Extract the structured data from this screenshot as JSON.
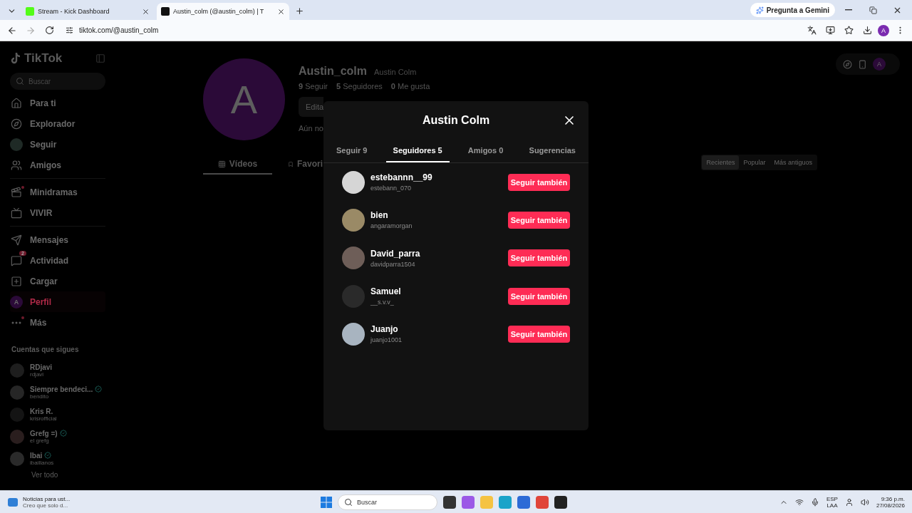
{
  "browser": {
    "tabs": [
      {
        "title": "Stream - Kick Dashboard",
        "selected": false
      },
      {
        "title": "Austin_colm (@austin_colm) | T",
        "selected": true
      }
    ],
    "gemini": "Pregunta a Gemini",
    "url": "tiktok.com/@austin_colm",
    "profile_initial": "A"
  },
  "sidebar": {
    "logo": "TikTok",
    "search": {
      "placeholder": "Buscar"
    },
    "groups": [
      [
        {
          "label": "Para ti",
          "kind": "icon",
          "selected": false,
          "dot": false
        },
        {
          "label": "Explorador",
          "kind": "icon",
          "selected": false,
          "dot": false
        },
        {
          "label": "Seguir",
          "kind": "photo",
          "selected": false,
          "dot": false
        },
        {
          "label": "Amigos",
          "kind": "icon",
          "selected": false,
          "dot": false
        }
      ],
      [
        {
          "label": "Minidramas",
          "kind": "icon",
          "selected": false,
          "dot": true
        },
        {
          "label": "VIVIR",
          "kind": "icon",
          "selected": false,
          "dot": false
        }
      ],
      [
        {
          "label": "Mensajes",
          "kind": "icon",
          "selected": false,
          "dot": false
        },
        {
          "label": "Actividad",
          "kind": "icon",
          "selected": false,
          "dot": false,
          "badge": "2"
        },
        {
          "label": "Cargar",
          "kind": "icon",
          "selected": false,
          "dot": false
        },
        {
          "label": "Perfil",
          "kind": "initial",
          "initial": "A",
          "selected": true,
          "dot": false
        },
        {
          "label": "Más",
          "kind": "icon",
          "selected": false,
          "dot": true
        }
      ]
    ],
    "following_title": "Cuentas que sigues",
    "accounts": [
      {
        "name": "RDjavi",
        "handle": "rdjavi",
        "verified": false
      },
      {
        "name": "Siempre bendeci...",
        "handle": "bendito",
        "verified": true
      },
      {
        "name": "Kris R.",
        "handle": "krisrofficial",
        "verified": false
      },
      {
        "name": "Grefg =)",
        "handle": "el grefg",
        "verified": true
      },
      {
        "name": "Ibai",
        "handle": "ibaillanos",
        "verified": true
      }
    ],
    "see_all": "Ver todo"
  },
  "profile": {
    "avatar_initial": "A",
    "username": "Austin_colm",
    "display_name": "Austin Colm",
    "stats": [
      {
        "count": "9",
        "label": "Seguir"
      },
      {
        "count": "5",
        "label": "Seguidores"
      },
      {
        "count": "0",
        "label": "Me gusta"
      }
    ],
    "edit_button": "Edita",
    "bio": "Aún no",
    "tabs": [
      {
        "label": "Vídeos",
        "selected": true
      },
      {
        "label": "Favori",
        "selected": false
      }
    ],
    "sort": [
      {
        "label": "Recientes",
        "selected": true
      },
      {
        "label": "Popular",
        "selected": false
      },
      {
        "label": "Más antiguos",
        "selected": false
      }
    ],
    "toolbar_initial": "A"
  },
  "modal": {
    "title": "Austin Colm",
    "tabs": [
      {
        "label": "Seguir 9",
        "selected": false
      },
      {
        "label": "Seguidores 5",
        "selected": true
      },
      {
        "label": "Amigos 0",
        "selected": false
      },
      {
        "label": "Sugerencias",
        "selected": false
      }
    ],
    "followers": [
      {
        "name": "estebannn__99",
        "handle": "estebann_070",
        "button": "Seguir también"
      },
      {
        "name": "bien",
        "handle": "angaramorgan",
        "button": "Seguir también"
      },
      {
        "name": "David_parra",
        "handle": "davidparra1504",
        "button": "Seguir también"
      },
      {
        "name": "Samuel",
        "handle": "__s.v.v_",
        "button": "Seguir también"
      },
      {
        "name": "Juanjo",
        "handle": "juanjo1001",
        "button": "Seguir también"
      }
    ]
  },
  "taskbar": {
    "news_title": "Noticias para ust...",
    "news_text": "Creo que solo d...",
    "search": "Buscar",
    "lang": "ESP",
    "region": "LAA",
    "time": "9:36 p.m.",
    "date": "27/08/2026"
  }
}
